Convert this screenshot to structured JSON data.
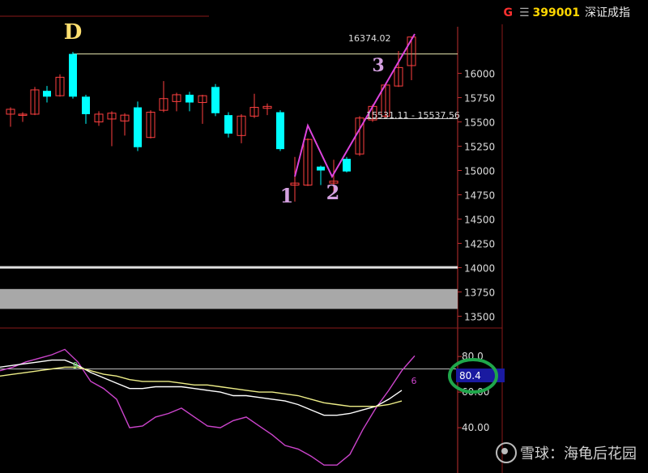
{
  "header": {
    "market_flag": "G",
    "code": "399001",
    "name": "深证成指"
  },
  "annotations": {
    "pattern_labels": [
      "D",
      "1",
      "2",
      "3"
    ],
    "high_value": "16374.02",
    "gap_range": "15531.11 - 15537.56",
    "kdj_j_marker": "9",
    "kdj_k_marker": "6",
    "current_indicator": "80.4"
  },
  "watermark": {
    "prefix": "雪球：",
    "author": "海龟后花园"
  },
  "colors": {
    "up": "#ff4040",
    "down": "#00ffff",
    "j_line": "#cc44cc",
    "k_line": "#ffffff",
    "d_line": "#eeee88",
    "highlight": "#1fa64a",
    "axis": "#c03030",
    "label": "#d4a0e0"
  },
  "chart_data": [
    {
      "type": "candlestick",
      "y_ticks": [
        16000,
        15750,
        15500,
        15250,
        15000,
        14750,
        14500,
        14250,
        14000,
        13750,
        13500
      ],
      "ylim": [
        13420,
        16480
      ],
      "candles": [
        {
          "o": 15580,
          "c": 15630,
          "h": 15650,
          "l": 15450
        },
        {
          "o": 15570,
          "c": 15580,
          "h": 15600,
          "l": 15500
        },
        {
          "o": 15580,
          "c": 15830,
          "h": 15860,
          "l": 15570
        },
        {
          "o": 15820,
          "c": 15760,
          "h": 15870,
          "l": 15700
        },
        {
          "o": 15770,
          "c": 15960,
          "h": 15990,
          "l": 15760
        },
        {
          "o": 16200,
          "c": 15760,
          "h": 16220,
          "l": 15740
        },
        {
          "o": 15760,
          "c": 15580,
          "h": 15780,
          "l": 15480
        },
        {
          "o": 15500,
          "c": 15580,
          "h": 15610,
          "l": 15460
        },
        {
          "o": 15530,
          "c": 15590,
          "h": 15610,
          "l": 15250
        },
        {
          "o": 15510,
          "c": 15570,
          "h": 15590,
          "l": 15360
        },
        {
          "o": 15650,
          "c": 15240,
          "h": 15710,
          "l": 15200
        },
        {
          "o": 15340,
          "c": 15600,
          "h": 15620,
          "l": 15330
        },
        {
          "o": 15620,
          "c": 15740,
          "h": 15920,
          "l": 15600
        },
        {
          "o": 15710,
          "c": 15780,
          "h": 15800,
          "l": 15610
        },
        {
          "o": 15780,
          "c": 15700,
          "h": 15810,
          "l": 15610
        },
        {
          "o": 15700,
          "c": 15770,
          "h": 15780,
          "l": 15480
        },
        {
          "o": 15860,
          "c": 15590,
          "h": 15890,
          "l": 15560
        },
        {
          "o": 15570,
          "c": 15380,
          "h": 15600,
          "l": 15340
        },
        {
          "o": 15360,
          "c": 15560,
          "h": 15580,
          "l": 15280
        },
        {
          "o": 15560,
          "c": 15650,
          "h": 15790,
          "l": 15540
        },
        {
          "o": 15640,
          "c": 15660,
          "h": 15690,
          "l": 15570
        },
        {
          "o": 15600,
          "c": 15220,
          "h": 15620,
          "l": 15200
        },
        {
          "o": 14850,
          "c": 14870,
          "h": 15140,
          "l": 14680
        },
        {
          "o": 14850,
          "c": 15320,
          "h": 15330,
          "l": 14840
        },
        {
          "o": 15040,
          "c": 15000,
          "h": 15050,
          "l": 14850
        },
        {
          "o": 14870,
          "c": 14890,
          "h": 15110,
          "l": 14780
        },
        {
          "o": 15120,
          "c": 14990,
          "h": 15140,
          "l": 14980
        },
        {
          "o": 15170,
          "c": 15540,
          "h": 15560,
          "l": 15150
        },
        {
          "o": 15520,
          "c": 15660,
          "h": 15680,
          "l": 15500
        },
        {
          "o": 15560,
          "c": 15880,
          "h": 15900,
          "l": 15540
        },
        {
          "o": 15870,
          "c": 16060,
          "h": 16230,
          "l": 15860
        },
        {
          "o": 16080,
          "c": 16374,
          "h": 16374.02,
          "l": 15930
        }
      ],
      "horizontal_lines": [
        16200,
        15534,
        14003
      ]
    },
    {
      "type": "line",
      "y_ticks": [
        80,
        60,
        40
      ],
      "y_tick_labels": [
        "80.0",
        "",
        "60.00",
        "40.00"
      ],
      "ylim": [
        20,
        96
      ],
      "series": [
        {
          "role": "J",
          "values": [
            72,
            74,
            77,
            79,
            81,
            84,
            77,
            66,
            62,
            56,
            40,
            41,
            46,
            48,
            51,
            46,
            41,
            40,
            44,
            46,
            41,
            36,
            30,
            28,
            24,
            19,
            19,
            25,
            39,
            51,
            61,
            72,
            80.4
          ]
        },
        {
          "role": "K",
          "values": [
            74,
            75,
            76,
            77,
            78,
            78,
            75,
            71,
            68,
            65,
            62,
            62,
            63,
            63,
            63,
            62,
            61,
            60,
            58,
            58,
            57,
            56,
            55,
            53,
            50,
            47,
            47,
            48,
            50,
            52,
            56,
            61
          ]
        },
        {
          "role": "D",
          "values": [
            69,
            70,
            71,
            72,
            73,
            74,
            74,
            72,
            70,
            69,
            67,
            66,
            66,
            66,
            65,
            64,
            64,
            63,
            62,
            61,
            60,
            60,
            59,
            58,
            56,
            54,
            53,
            52,
            52,
            52,
            53,
            55
          ]
        }
      ]
    }
  ]
}
